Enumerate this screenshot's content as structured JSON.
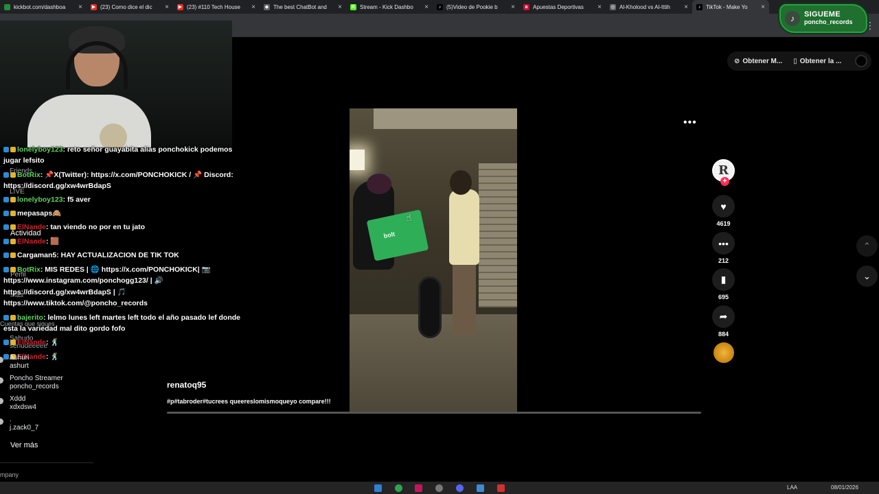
{
  "browser": {
    "tabs": [
      {
        "title": "kickbot.com/dashboa",
        "fav_color": "#1f8f3a",
        "fav_glyph": ""
      },
      {
        "title": "(23) Como dice el dic",
        "fav_color": "#e52d27",
        "fav_glyph": "▶"
      },
      {
        "title": "(23) #110 Tech House",
        "fav_color": "#e52d27",
        "fav_glyph": "▶"
      },
      {
        "title": "The best ChatBot and",
        "fav_color": "#5f6368",
        "fav_glyph": "◆"
      },
      {
        "title": "Stream - Kick Dashbo",
        "fav_color": "#53fc18",
        "fav_glyph": "K"
      },
      {
        "title": "(5)Video de Pookie b",
        "fav_color": "#000000",
        "fav_glyph": "♪"
      },
      {
        "title": "Apuestas Deportivas",
        "fav_color": "#c8102e",
        "fav_glyph": "a"
      },
      {
        "title": "Al-Kholood vs Al-Ittih",
        "fav_color": "#5f6368",
        "fav_glyph": "◎"
      },
      {
        "title": "TikTok - Make Yo",
        "fav_color": "#000000",
        "fav_glyph": "♪"
      }
    ]
  },
  "overlay": {
    "follow_line1": "SIGUEME",
    "follow_line2": "poncho_records"
  },
  "chat": [
    {
      "user": "lonelyboy123",
      "user_color": "green",
      "text": ": reto señor guayabita alias ponchokick podemos"
    },
    {
      "user": "",
      "user_color": "white",
      "text": "jugar lefsito"
    },
    {
      "user": "BotRix",
      "user_color": "green",
      "text": ": 📌X(Twitter): https://x.com/PONCHOKICK / 📌 Discord:"
    },
    {
      "user": "",
      "user_color": "white",
      "text": "https://discord.gg/xw4wrBdapS"
    },
    {
      "user": "lonelyboy123",
      "user_color": "green",
      "text": ": f5 aver"
    },
    {
      "user": "mepasaps",
      "user_color": "white",
      "text": "🙈"
    },
    {
      "user": "ElNande",
      "user_color": "red",
      "text": ": tan viendo no por en tu jato"
    },
    {
      "user": "ElNande",
      "user_color": "red",
      "text": ": 🟫"
    },
    {
      "user": "Cargaman5",
      "user_color": "white",
      "text": ": HAY ACTUALIZACION DE TIK TOK"
    },
    {
      "user": "BotRix",
      "user_color": "green",
      "text": ": MIS REDES | 🌐 https://x.com/PONCHOKICK| 📷"
    },
    {
      "user": "",
      "user_color": "white",
      "text": "https://www.instagram.com/ponchogg123/ | 🔊"
    },
    {
      "user": "",
      "user_color": "white",
      "text": "https://discord.gg/xw4wrBdapS | 🎵"
    },
    {
      "user": "",
      "user_color": "white",
      "text": "https://www.tiktok.com/@poncho_records"
    },
    {
      "user": "bajerito",
      "user_color": "green",
      "text": ": lelmo lunes left martes left todo el año pasado lef donde"
    },
    {
      "user": "",
      "user_color": "white",
      "text": "esta la variedad mal dito gordo fofo"
    },
    {
      "user": "ElNande",
      "user_color": "red",
      "text": ": 🕺"
    },
    {
      "user": "ElNande",
      "user_color": "red",
      "text": ": 🕺"
    }
  ],
  "sidebar_ghost": {
    "friends": "Friends",
    "live": "LIVE",
    "activity": "Actividad",
    "profile": "Perfil",
    "more": "Más",
    "following_hint": "Cuentas que sigues",
    "s1_name": "Sabudo",
    "s1_handle": "senudeeeee"
  },
  "sidebar": {
    "accounts": [
      {
        "name": "Ashuri",
        "handle": "ashurt"
      },
      {
        "name": "Poncho Streamer",
        "handle": "poncho_records"
      },
      {
        "name": "Xddd",
        "handle": "xdxdsw4"
      },
      {
        "name": ".",
        "handle": "j.zack0_7"
      }
    ],
    "see_more": "Ver más",
    "company": "mpany"
  },
  "tiktok": {
    "get_app_1": "Obtener M...",
    "get_app_2": "Obtener la ...",
    "more_menu": "•••",
    "creator_initial": "R",
    "likes": "4619",
    "comments": "212",
    "saves": "695",
    "shares": "884",
    "username": "renatoq95",
    "description": "#p#tabroder#tucrees queereslomismoqueyo compare!!!",
    "delivery_box": "bolt",
    "progress": 0.0
  },
  "taskbar": {
    "lang": "LAA",
    "date": "08/01/2026"
  }
}
